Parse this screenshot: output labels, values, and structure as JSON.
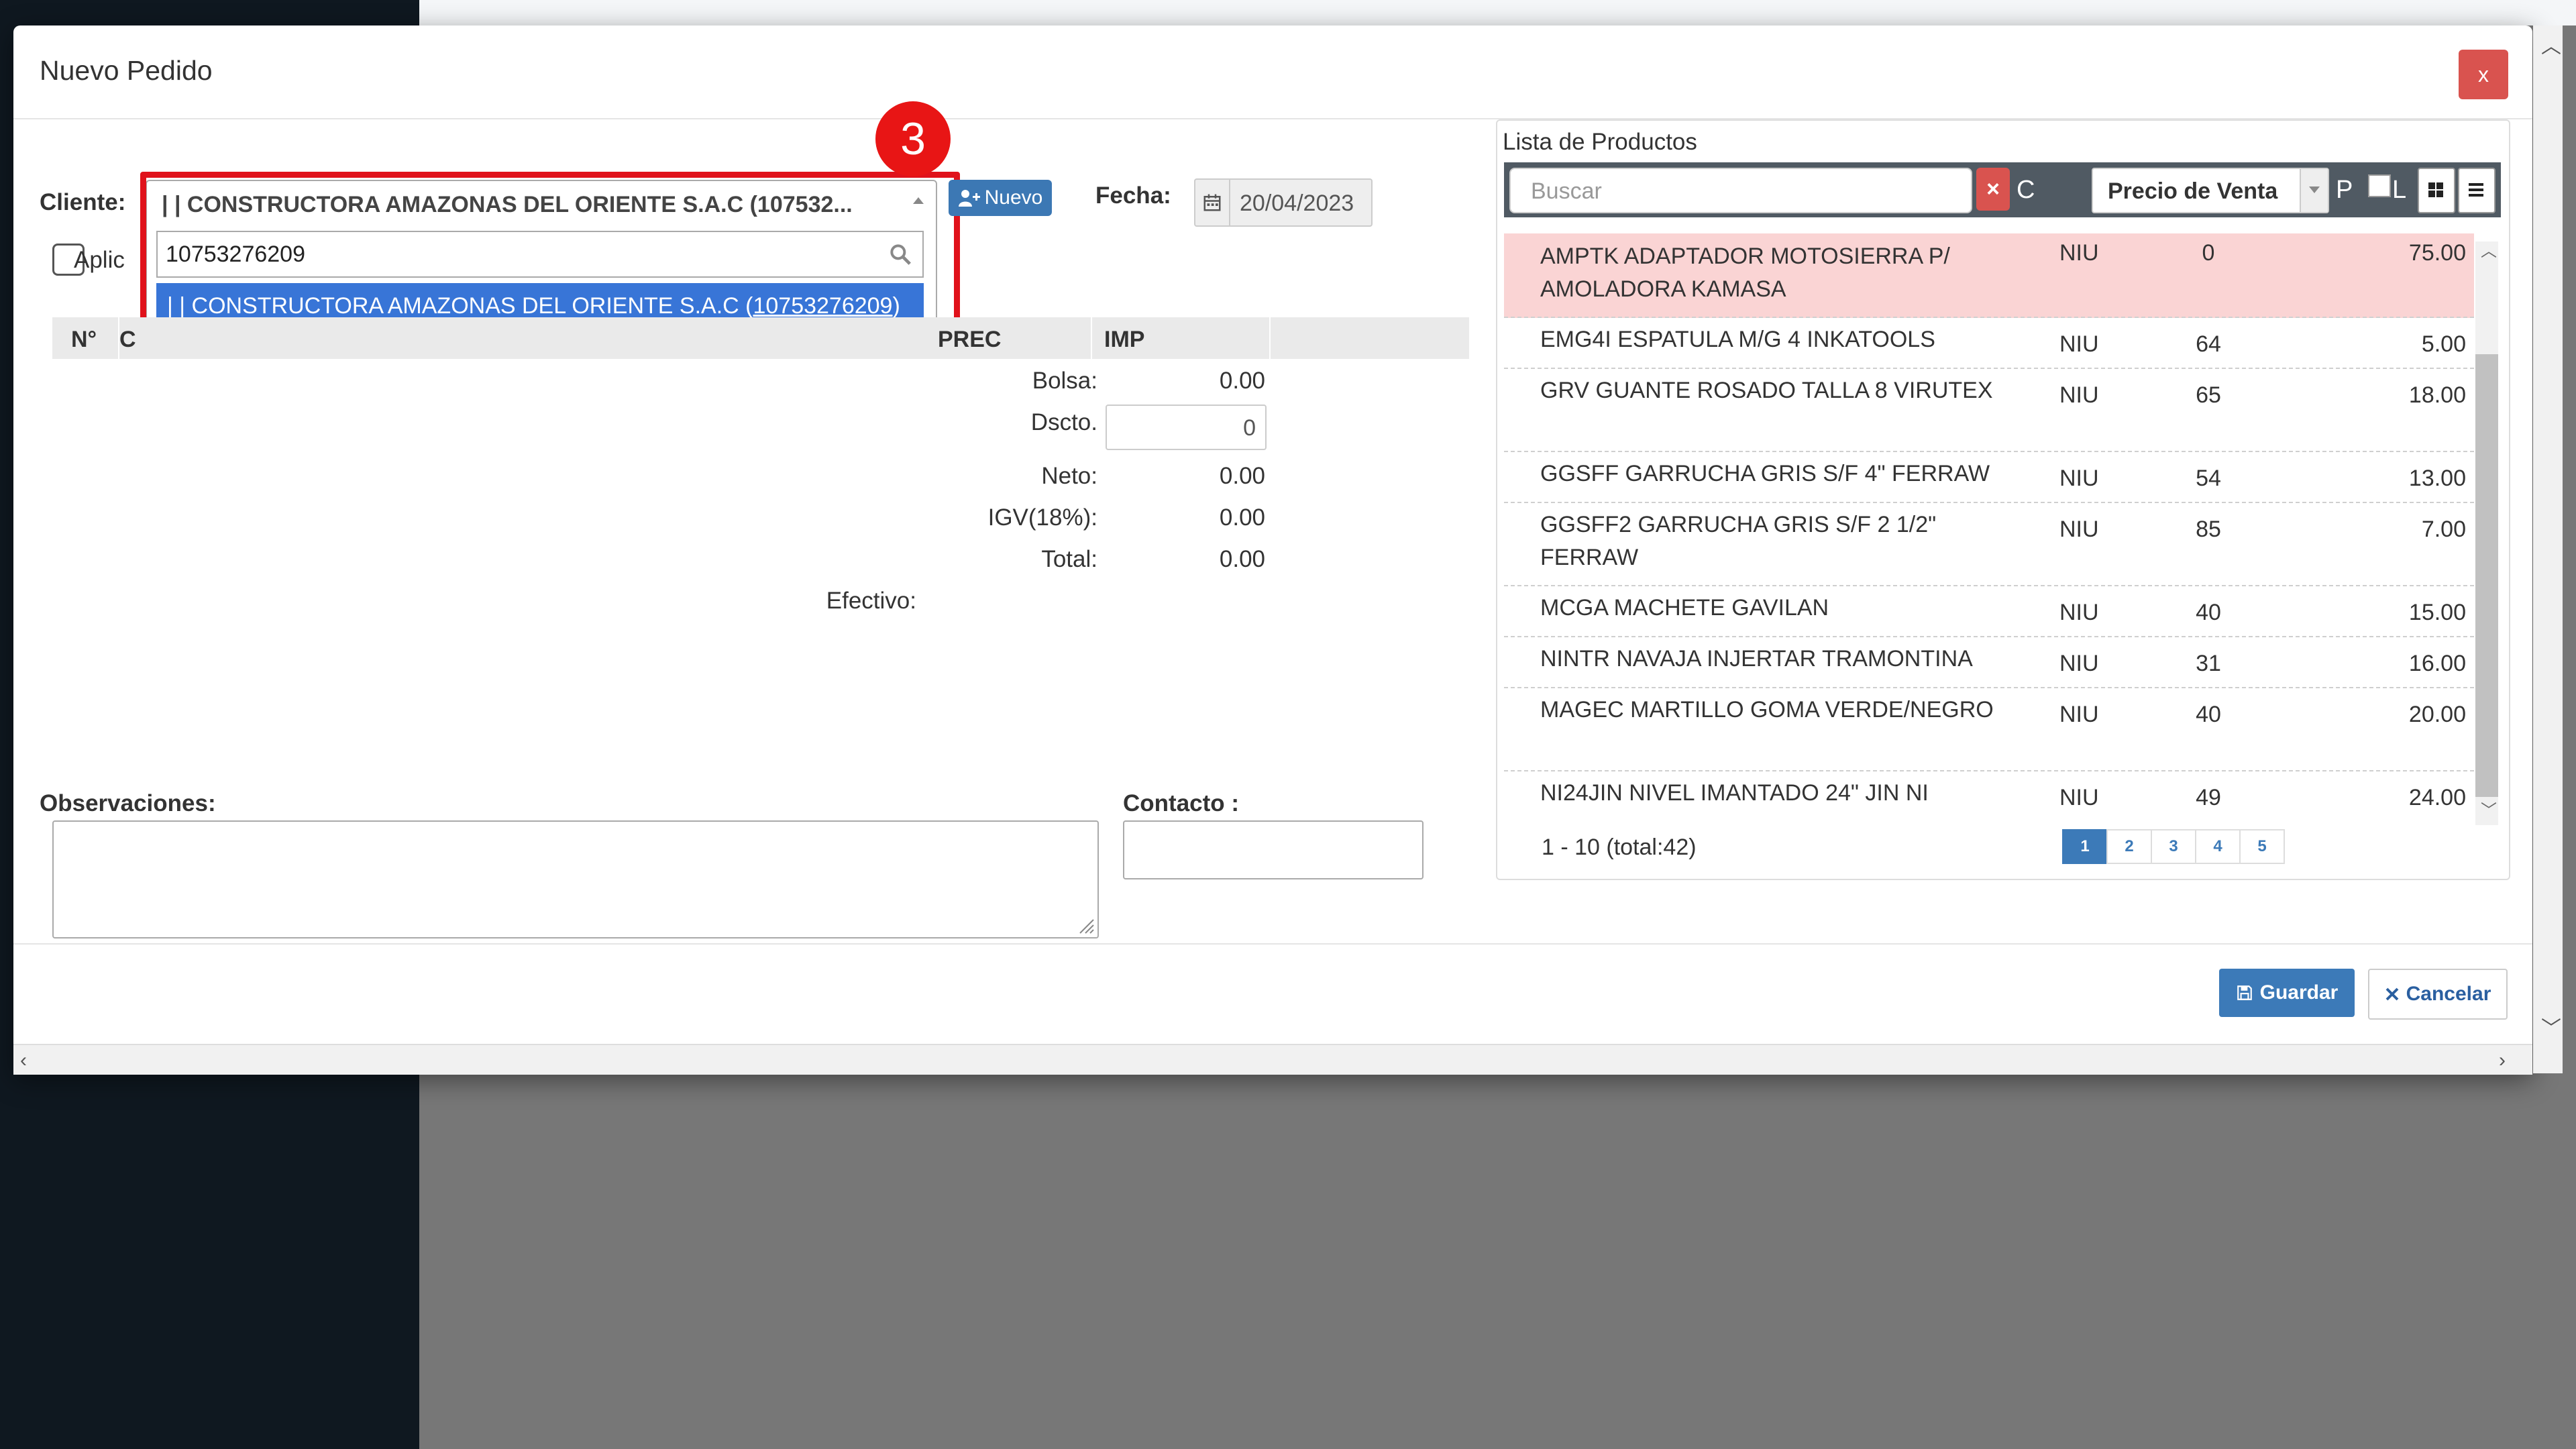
{
  "modal": {
    "title": "Nuevo Pedido",
    "close_label": "x"
  },
  "step_badge": "3",
  "cliente": {
    "label": "Cliente:",
    "selected": "| | CONSTRUCTORA AMAZONAS DEL ORIENTE S.A.C (107532...",
    "search_value": "10753276209",
    "option_prefix": "| | CONSTRUCTORA AMAZONAS DEL ORIENTE S.A.C (",
    "option_match": "10753276209",
    "option_suffix": ")"
  },
  "nuevo_button": "Nuevo",
  "fecha": {
    "label": "Fecha:",
    "value": "20/04/2023"
  },
  "aplicar_label": "Aplic",
  "table": {
    "headers": [
      "N°",
      "C",
      "PREC",
      "IMP"
    ]
  },
  "totals": {
    "bolsa_label": "Bolsa:",
    "bolsa": "0.00",
    "dscto_label": "Dscto.",
    "dscto": "0",
    "neto_label": "Neto:",
    "neto": "0.00",
    "igv_label": "IGV(18%):",
    "igv": "0.00",
    "total_label": "Total:",
    "total": "0.00",
    "efectivo_label": "Efectivo:"
  },
  "observaciones_label": "Observaciones:",
  "contacto_label": "Contacto :",
  "buttons": {
    "guardar": "Guardar",
    "cancelar": "Cancelar"
  },
  "products": {
    "title": "Lista de Productos",
    "search_placeholder": "Buscar",
    "clear_label": "×",
    "letter_c": "C",
    "price_mode": "Precio de Venta",
    "letter_p": "P",
    "letter_l": "L",
    "rows": [
      {
        "name": "AMPTK ADAPTADOR MOTOSIERRA P/ AMOLADORA KAMASA",
        "unit": "NIU",
        "stock": "0",
        "price": "75.00"
      },
      {
        "name": "EMG4I ESPATULA M/G 4 INKATOOLS",
        "unit": "NIU",
        "stock": "64",
        "price": "5.00"
      },
      {
        "name": "GRV GUANTE ROSADO TALLA 8 VIRUTEX",
        "unit": "NIU",
        "stock": "65",
        "price": "18.00"
      },
      {
        "name": "GGSFF GARRUCHA GRIS S/F 4\" FERRAW",
        "unit": "NIU",
        "stock": "54",
        "price": "13.00"
      },
      {
        "name": "GGSFF2 GARRUCHA GRIS S/F 2 1/2\" FERRAW",
        "unit": "NIU",
        "stock": "85",
        "price": "7.00"
      },
      {
        "name": "MCGA MACHETE GAVILAN",
        "unit": "NIU",
        "stock": "40",
        "price": "15.00"
      },
      {
        "name": "NINTR NAVAJA INJERTAR TRAMONTINA",
        "unit": "NIU",
        "stock": "31",
        "price": "16.00"
      },
      {
        "name": "MAGEC MARTILLO GOMA VERDE/NEGRO",
        "unit": "NIU",
        "stock": "40",
        "price": "20.00"
      },
      {
        "name": "NI24JIN NIVEL IMANTADO 24\" JIN NI",
        "unit": "NIU",
        "stock": "49",
        "price": "24.00"
      }
    ],
    "pager_info": "1 - 10 (total:42)",
    "pages": [
      "1",
      "2",
      "3",
      "4",
      "5"
    ]
  },
  "colors": {
    "primary": "#3c7ab8",
    "danger": "#d9534f",
    "highlight": "#e0121b",
    "row_warning": "#fad4d4"
  }
}
